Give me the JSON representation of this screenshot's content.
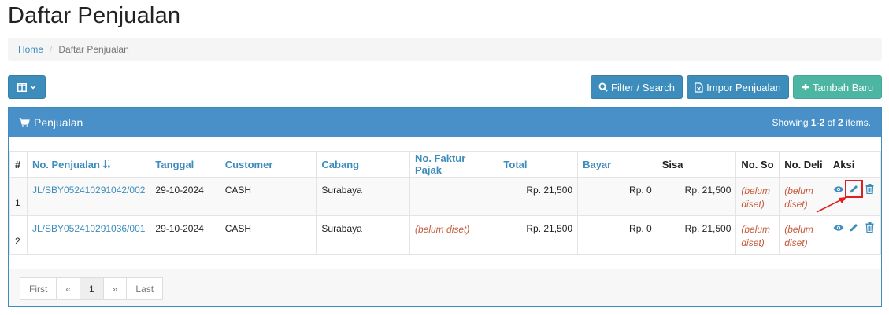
{
  "page": {
    "title": "Daftar Penjualan"
  },
  "breadcrumb": {
    "home": "Home",
    "current": "Daftar Penjualan"
  },
  "toolbar": {
    "columns_icon": "columns-icon",
    "filter_label": "Filter / Search",
    "import_label": "Impor Penjualan",
    "add_label": "Tambah Baru"
  },
  "panel": {
    "title": "Penjualan",
    "summary_prefix": "Showing",
    "summary_range": "1-2",
    "summary_of": "of",
    "summary_total": "2",
    "summary_suffix": "items."
  },
  "table": {
    "headers": [
      "#",
      "No. Penjualan",
      "Tanggal",
      "Customer",
      "Cabang",
      "No. Faktur Pajak",
      "Total",
      "Bayar",
      "Sisa",
      "No. So",
      "No. Deli",
      "Aksi"
    ],
    "rows": [
      {
        "no": "1",
        "penjualan": "JL/SBY052410291042/002",
        "tanggal": "29-10-2024",
        "customer": "CASH",
        "cabang": "Surabaya",
        "faktur": "",
        "total": "Rp. 21,500",
        "bayar": "Rp. 0",
        "sisa": "Rp. 21,500",
        "so": "(belum diset)",
        "deli": "(belum diset)"
      },
      {
        "no": "2",
        "penjualan": "JL/SBY052410291036/001",
        "tanggal": "29-10-2024",
        "customer": "CASH",
        "cabang": "Surabaya",
        "faktur": "(belum diset)",
        "total": "Rp. 21,500",
        "bayar": "Rp. 0",
        "sisa": "Rp. 21,500",
        "so": "(belum diset)",
        "deli": "(belum diset)"
      }
    ]
  },
  "pagination": {
    "first": "First",
    "prev": "«",
    "page": "1",
    "next": "»",
    "last": "Last"
  },
  "colors": {
    "primary": "#3c8dbc",
    "teal": "#4cb6a3",
    "notset": "#c55a3a",
    "highlight": "#e02020"
  }
}
